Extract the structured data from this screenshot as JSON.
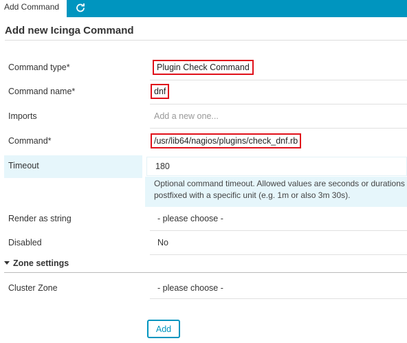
{
  "tabs": {
    "active_label": "Add Command",
    "refresh_icon": "refresh-icon"
  },
  "page": {
    "title": "Add new Icinga Command"
  },
  "form": {
    "command_type": {
      "label": "Command type*",
      "value": "Plugin Check Command"
    },
    "command_name": {
      "label": "Command name*",
      "value": "dnf"
    },
    "imports": {
      "label": "Imports",
      "placeholder": "Add a new one..."
    },
    "command": {
      "label": "Command*",
      "value": "/usr/lib64/nagios/plugins/check_dnf.rb"
    },
    "timeout": {
      "label": "Timeout",
      "value": "180",
      "description": "Optional command timeout. Allowed values are seconds or durations postfixed with a specific unit (e.g. 1m or also 3m 30s)."
    },
    "render_as_string": {
      "label": "Render as string",
      "value": "- please choose -"
    },
    "disabled": {
      "label": "Disabled",
      "value": "No"
    }
  },
  "zone_settings": {
    "heading": "Zone settings",
    "cluster_zone": {
      "label": "Cluster Zone",
      "value": "- please choose -"
    }
  },
  "actions": {
    "add_label": "Add"
  },
  "colors": {
    "accent": "#0095bf",
    "highlight_box": "#e0101a",
    "timeout_bg": "#e6f6fb"
  }
}
